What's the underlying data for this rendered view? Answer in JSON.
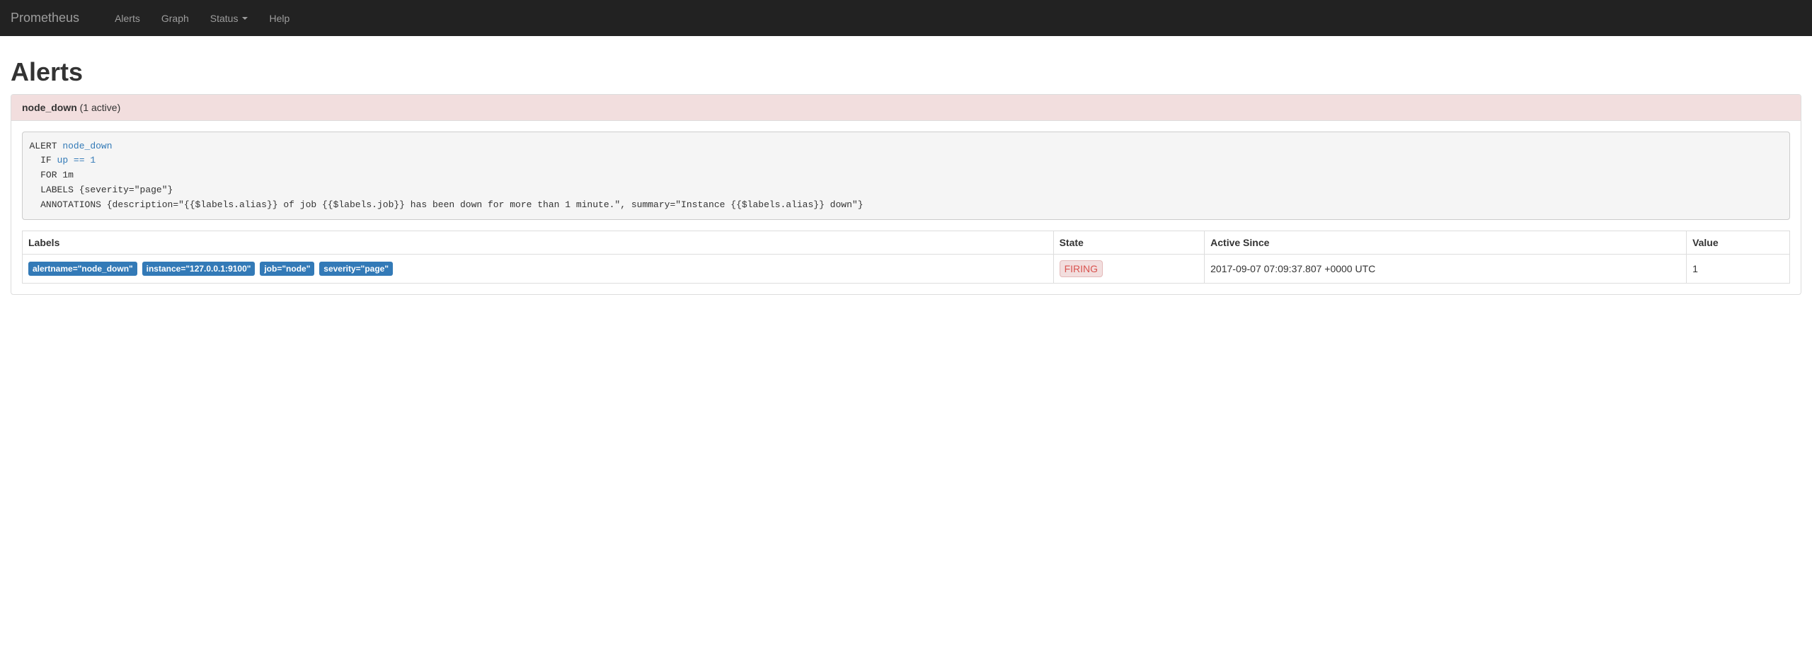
{
  "navbar": {
    "brand": "Prometheus",
    "links": {
      "alerts": "Alerts",
      "graph": "Graph",
      "status": "Status",
      "help": "Help"
    }
  },
  "page": {
    "title": "Alerts"
  },
  "alert": {
    "name": "node_down",
    "active_text": " (1 active)",
    "rule_html": "ALERT <span class=\"blue\">node_down</span>\n  IF <span class=\"blue\">up == 1</span>\n  FOR 1m\n  LABELS {severity=\"page\"}\n  ANNOTATIONS {description=\"{{$labels.alias}} of job {{$labels.job}} has been down for more than 1 minute.\", summary=\"Instance {{$labels.alias}} down\"}",
    "table": {
      "headers": {
        "labels": "Labels",
        "state": "State",
        "active_since": "Active Since",
        "value": "Value"
      },
      "row": {
        "labels": [
          "alertname=\"node_down\"",
          "instance=\"127.0.0.1:9100\"",
          "job=\"node\"",
          "severity=\"page\""
        ],
        "state": "FIRING",
        "active_since": "2017-09-07 07:09:37.807 +0000 UTC",
        "value": "1"
      }
    }
  }
}
